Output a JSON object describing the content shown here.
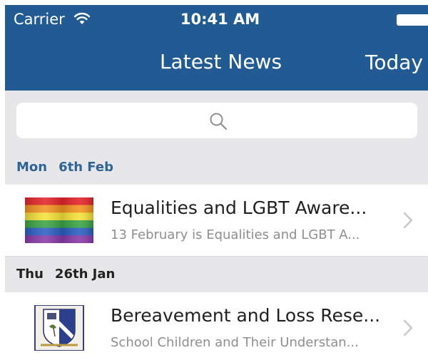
{
  "status_bar": {
    "carrier": "Carrier",
    "time": "10:41 AM",
    "icons": [
      "wifi-icon",
      "battery-icon"
    ]
  },
  "nav": {
    "title": "Latest News",
    "right_button": "Today"
  },
  "search": {
    "placeholder": "",
    "icon": "search-icon"
  },
  "sections": [
    {
      "day": "Mon",
      "date": "6th Feb",
      "items": [
        {
          "title": "Equalities and LGBT Aware...",
          "subtitle": "13 February is Equalities and LGBT A...",
          "thumbnail": "rainbow-flag-image"
        }
      ]
    },
    {
      "day": "Thu",
      "date": "26th Jan",
      "items": [
        {
          "title": "Bereavement and Loss Rese...",
          "subtitle": "School Children and Their Understan...",
          "thumbnail": "school-crest-image"
        }
      ]
    }
  ],
  "colors": {
    "nav_bar": "#225b94",
    "section_bg": "#e7e7ea",
    "section_accent": "#2f6497",
    "subtitle": "#8e8e93"
  }
}
